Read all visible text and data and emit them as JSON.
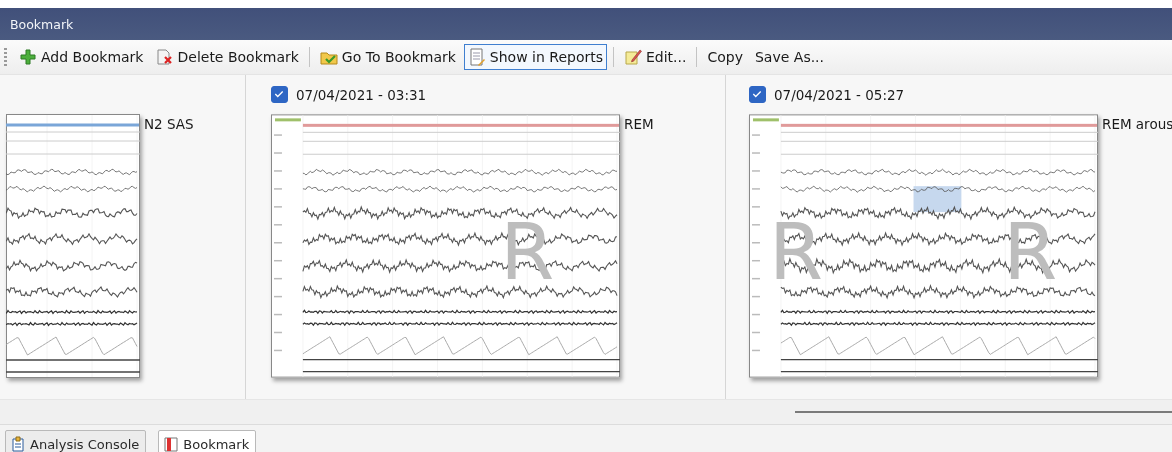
{
  "window": {
    "title": "Bookmark"
  },
  "toolbar": [
    {
      "kind": "icon_button",
      "label": "Add Bookmark",
      "selected": false
    },
    {
      "kind": "icon_button",
      "label": "Delete Bookmark",
      "selected": false
    },
    {
      "kind": "separator"
    },
    {
      "kind": "icon_button",
      "label": "Go To Bookmark",
      "selected": false
    },
    {
      "kind": "icon_button",
      "label": "Show in Reports",
      "selected": true
    },
    {
      "kind": "separator"
    },
    {
      "kind": "icon_button",
      "label": "Edit...",
      "selected": false
    },
    {
      "kind": "separator"
    },
    {
      "kind": "text_button",
      "label": "Copy",
      "selected": false
    },
    {
      "kind": "text_button",
      "label": "Save As...",
      "selected": false
    }
  ],
  "cards": [
    {
      "label": "N2 SAS",
      "color": "#7aa6d8"
    },
    {
      "date": "07/04/2021 - 03:31",
      "checked": true,
      "label": "REM",
      "color": "#e09a9a",
      "stage_letters": [
        "R"
      ]
    },
    {
      "date": "07/04/2021 - 05:27",
      "checked": true,
      "label": "REM arous",
      "color": "#e09a9a",
      "event": true,
      "stage_letters": [
        "R",
        "R"
      ]
    }
  ],
  "bottom_tabs": [
    {
      "label": "Analysis Console",
      "selected": false
    },
    {
      "label": "Bookmark",
      "selected": true
    }
  ]
}
